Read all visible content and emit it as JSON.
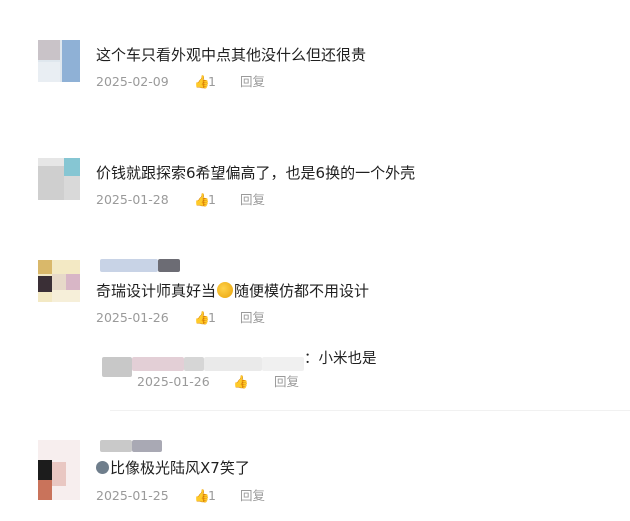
{
  "comments": [
    {
      "text": "这个车只看外观中点其他没什么但还很贵",
      "date": "2025-02-09",
      "likes": "1",
      "reply": "回复"
    },
    {
      "text": "价钱就跟探索6希望偏高了，也是6换的一个外壳",
      "date": "2025-01-28",
      "likes": "1",
      "reply": "回复"
    },
    {
      "text_before": "奇瑞设计师真好当",
      "text_after": "随便模仿都不用设计",
      "date": "2025-01-26",
      "likes": "1",
      "reply": "回复",
      "sub_reply": {
        "text": "：小米也是",
        "date": "2025-01-26",
        "reply": "回复"
      }
    },
    {
      "text": "比像极光陆风X7笑了",
      "date": "2025-01-25",
      "likes": "1",
      "reply": "回复"
    }
  ],
  "icons": {
    "like": "thumbs-up-icon",
    "emoji": "laughing-face-emoji"
  }
}
